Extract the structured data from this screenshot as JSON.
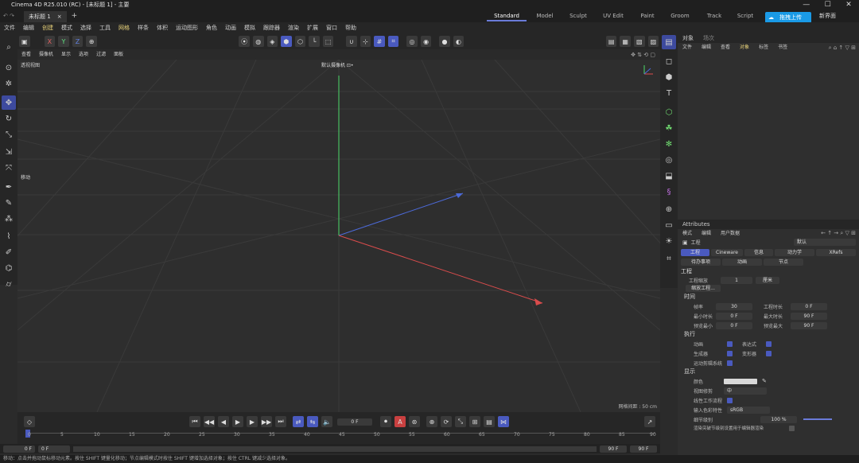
{
  "window": {
    "title": "Cinema 4D R25.010 (RC) - [未标题 1] - 主要",
    "controls": [
      "—",
      "☐",
      "✕"
    ]
  },
  "tabs": {
    "doc": "未标题 1",
    "close": "×",
    "add": "+"
  },
  "layouts": [
    "Standard",
    "Model",
    "Sculpt",
    "UV Edit",
    "Paint",
    "Groom",
    "Track",
    "Script"
  ],
  "layout_active": "Standard",
  "upload_label": "拖拽上传",
  "new_interface": "新界面",
  "menu": [
    "文件",
    "编辑",
    "创建",
    "模式",
    "选择",
    "工具",
    "网格",
    "样条",
    "体积",
    "运动图形",
    "角色",
    "动画",
    "模拟",
    "跟踪器",
    "渲染",
    "扩展",
    "窗口",
    "帮助"
  ],
  "axes": {
    "x": "X",
    "y": "Y",
    "z": "Z"
  },
  "vp_menu": [
    "查看",
    "摄像机",
    "显示",
    "选项",
    "过滤",
    "面板"
  ],
  "viewport": {
    "view_name": "透视视图",
    "camera": "默认摄像机 ⊡•",
    "grid_spacing": "网格间距 : 50 cm",
    "move_tip": "移动"
  },
  "timeline": {
    "frame": "0 F",
    "start": "0 F",
    "start2": "0 F",
    "end": "90 F",
    "end2": "90 F",
    "ticks": [
      "0",
      "5",
      "10",
      "15",
      "20",
      "25",
      "30",
      "35",
      "40",
      "45",
      "50",
      "55",
      "60",
      "65",
      "70",
      "75",
      "80",
      "85",
      "90"
    ]
  },
  "status": "移动：点击并拖动鼠标移动元素。按住 SHIFT 键量化移动；节点编辑模式时按住 SHIFT 键增加选择对象；按住 CTRL 键减少选择对象。",
  "objmgr": {
    "tabs": [
      "对象",
      "场次"
    ],
    "menu": [
      "文件",
      "编辑",
      "查看",
      "对象",
      "标签",
      "书签"
    ]
  },
  "attr": {
    "title": "Attributes",
    "menu": [
      "模式",
      "编辑",
      "用户数据"
    ],
    "object": "工程",
    "dropdown": "默认",
    "tabs": [
      "工程",
      "Cineware",
      "信息",
      "动力学",
      "XRefs"
    ],
    "tabs2": [
      "待办事项",
      "动画",
      "节点"
    ],
    "section_project": "工程",
    "scale_label": "工程缩放",
    "scale_value": "1",
    "scale_unit": "厘米",
    "scale_btn": "缩放工程...",
    "section_time": "时间",
    "fps_label": "帧率",
    "fps": "30",
    "projtime_label": "工程时长",
    "projtime": "0 F",
    "mintime_label": "最小时长",
    "mintime": "0 F",
    "maxtime_label": "最大时长",
    "maxtime": "90 F",
    "prevmin_label": "预览最小",
    "prevmin": "0 F",
    "prevmax_label": "预览最大",
    "prevmax": "90 F",
    "section_exec": "执行",
    "anim": "动画",
    "expr": "表达式",
    "gen": "生成器",
    "deform": "变形器",
    "motion": "运动剪辑系统",
    "section_display": "显示",
    "color_label": "颜色",
    "lod_label": "视图修剪",
    "lod": "中",
    "linear_label": "线性工作流程",
    "input_label": "输入色彩特性",
    "input": "sRGB",
    "detail_label": "细节级别",
    "detail": "100 %",
    "render_lod": "渲染突破节级别设置用于编辑器渲染"
  },
  "colors": {
    "accent": "#4a5abf",
    "x_axis": "#d94c4c",
    "y_axis": "#4cd96a",
    "z_axis": "#4c6ad9"
  }
}
